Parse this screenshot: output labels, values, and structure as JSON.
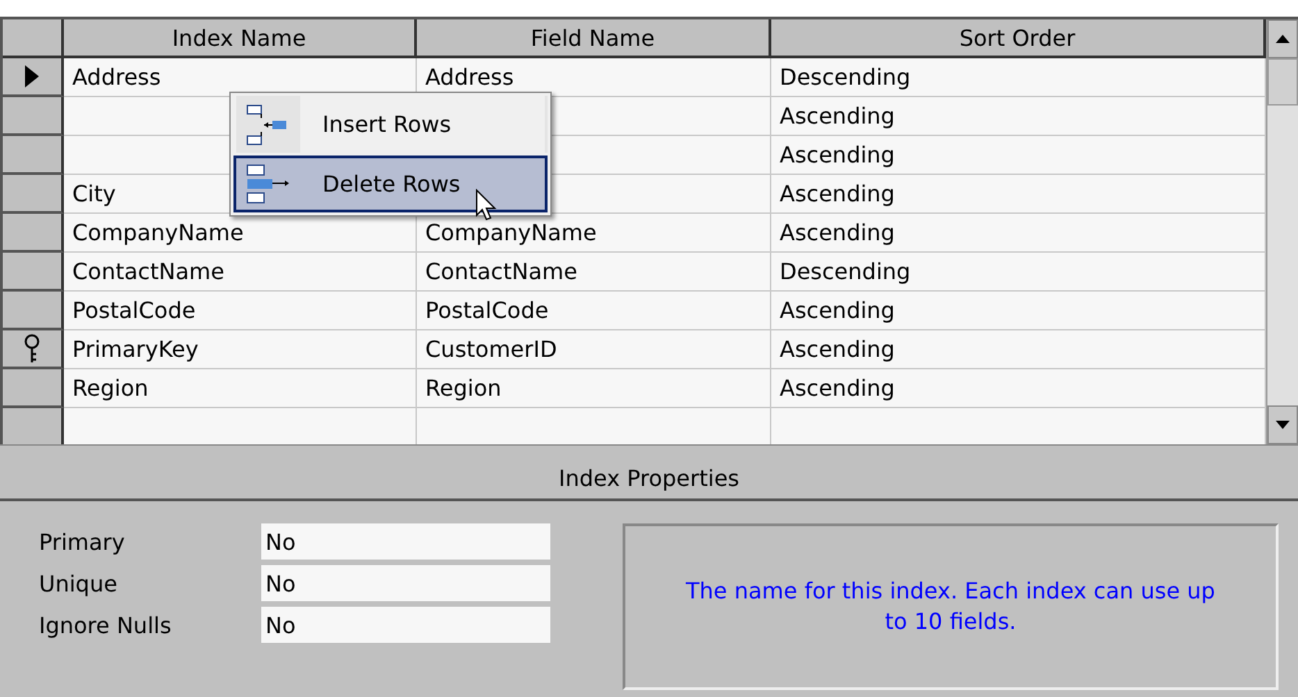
{
  "grid": {
    "columns": [
      "Index Name",
      "Field Name",
      "Sort Order"
    ],
    "rows": [
      {
        "index_name": "Address",
        "field_name": "Address",
        "sort_order": "Descending",
        "selected": true,
        "primary_key": false
      },
      {
        "sort_order": "Ascending",
        "selected": false,
        "primary_key": false
      },
      {
        "sort_order": "Ascending",
        "selected": false,
        "primary_key": false
      },
      {
        "index_name": "City",
        "sort_order": "Ascending",
        "selected": false,
        "primary_key": false
      },
      {
        "index_name": "CompanyName",
        "field_name": "CompanyName",
        "sort_order": "Ascending",
        "selected": false,
        "primary_key": false
      },
      {
        "index_name": "ContactName",
        "field_name": "ContactName",
        "sort_order": "Descending",
        "selected": false,
        "primary_key": false
      },
      {
        "index_name": "PostalCode",
        "field_name": "PostalCode",
        "sort_order": "Ascending",
        "selected": false,
        "primary_key": false
      },
      {
        "index_name": "PrimaryKey",
        "field_name": "CustomerID",
        "sort_order": "Ascending",
        "selected": false,
        "primary_key": true
      },
      {
        "index_name": "Region",
        "field_name": "Region",
        "sort_order": "Ascending",
        "selected": false,
        "primary_key": false
      }
    ]
  },
  "context_menu": {
    "items": [
      {
        "kind": "insert",
        "label": "Insert Rows",
        "selected": false
      },
      {
        "kind": "delete",
        "label": "Delete Rows",
        "selected": true
      }
    ]
  },
  "properties": {
    "title": "Index Properties",
    "fields": [
      {
        "label": "Primary",
        "value": "No"
      },
      {
        "label": "Unique",
        "value": "No"
      },
      {
        "label": "Ignore Nulls",
        "value": "No"
      }
    ],
    "help": "The name for this index.  Each index can use up to 10 fields."
  }
}
